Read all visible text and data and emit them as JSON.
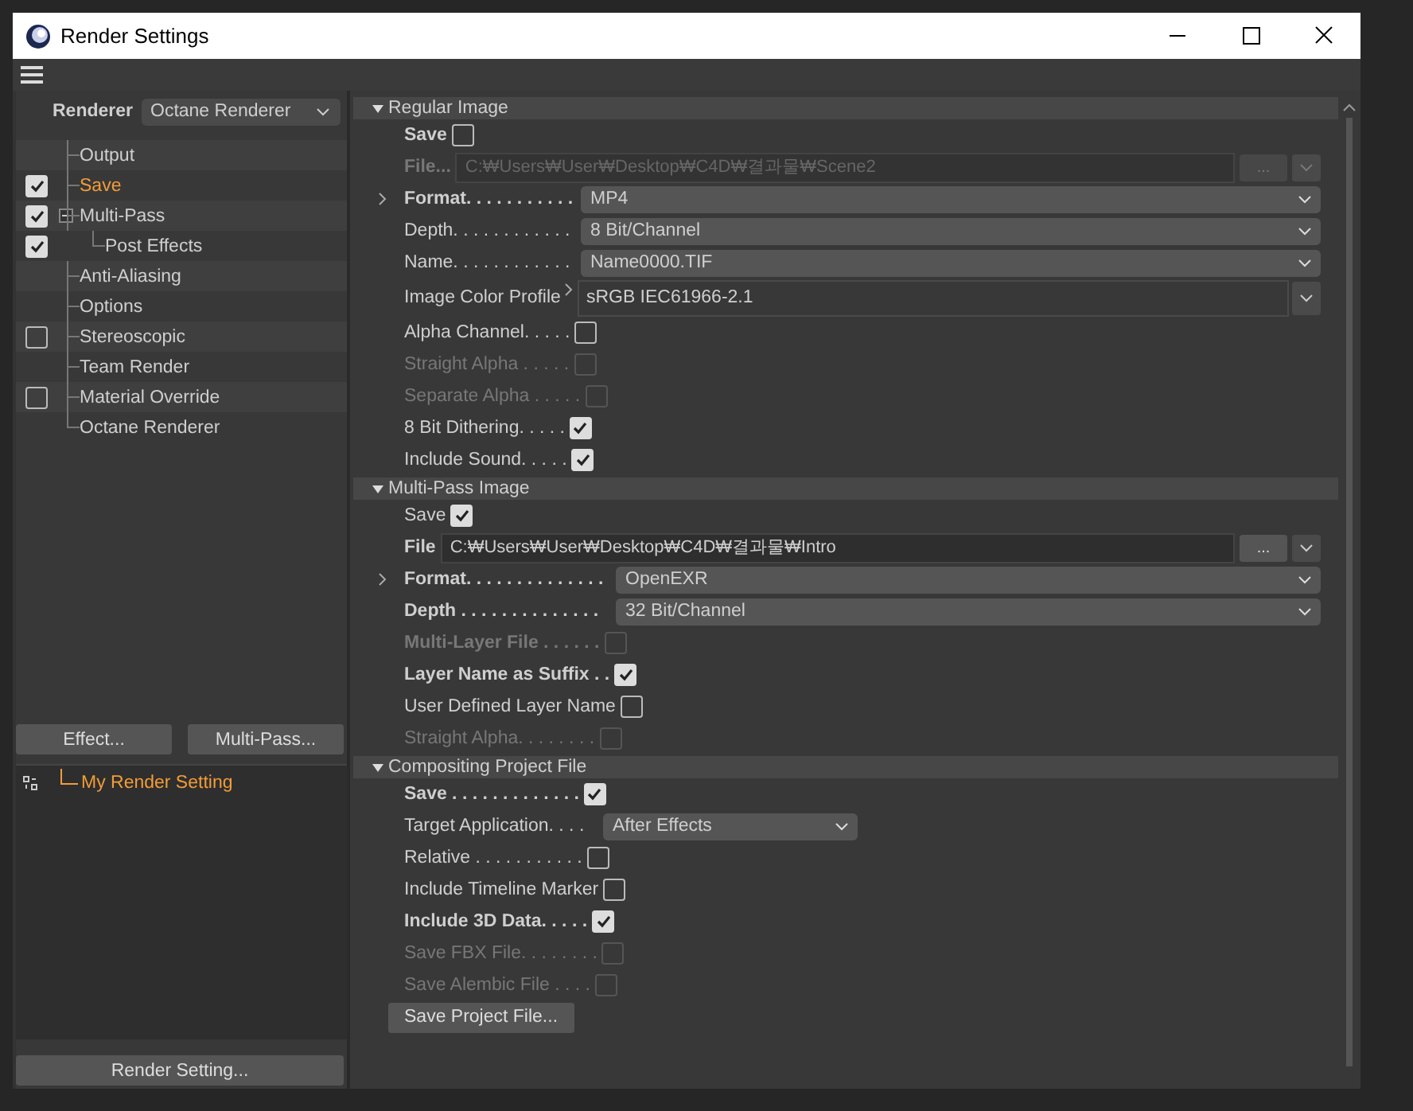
{
  "window": {
    "title": "Render Settings"
  },
  "renderer": {
    "label": "Renderer",
    "value": "Octane Renderer"
  },
  "tree": [
    {
      "label": "Output",
      "selected": false
    },
    {
      "label": "Save",
      "selected": true,
      "checked": true
    },
    {
      "label": "Multi-Pass",
      "selected": false,
      "checked": true,
      "expanded": true,
      "children": [
        {
          "label": "Post Effects",
          "selected": false,
          "checked": true
        }
      ]
    },
    {
      "label": "Anti-Aliasing",
      "selected": false
    },
    {
      "label": "Options",
      "selected": false
    },
    {
      "label": "Stereoscopic",
      "selected": false,
      "checked": false
    },
    {
      "label": "Team Render",
      "selected": false
    },
    {
      "label": "Material Override",
      "selected": false,
      "checked": false
    },
    {
      "label": "Octane Renderer",
      "selected": false
    }
  ],
  "left_buttons": [
    "Effect...",
    "Multi-Pass..."
  ],
  "presets": [
    {
      "label": "My Render Setting",
      "selected": true
    }
  ],
  "bottom_button": "Render Setting...",
  "sections": [
    {
      "title": "Regular Image",
      "expanded": true,
      "rows": [
        {
          "kind": "checkbox",
          "label": "Save",
          "bold": true,
          "disabled": false,
          "checked": false
        },
        {
          "kind": "file",
          "label": "File...",
          "bold": true,
          "disabled": true,
          "value": "C:₩Users₩User₩Desktop₩C4D₩결과물₩Scene2",
          "browse": "..."
        },
        {
          "kind": "dropdown",
          "label": "Format. . . . . . . . . . .",
          "bold": true,
          "disabled": false,
          "expandable": true,
          "value": "MP4"
        },
        {
          "kind": "dropdown",
          "label": "Depth. . . . . . . . . . . .",
          "bold": false,
          "disabled": false,
          "value": "8 Bit/Channel"
        },
        {
          "kind": "dropdown",
          "label": "Name. . . . . . . . . . . .",
          "bold": false,
          "disabled": false,
          "value": "Name0000.TIF"
        },
        {
          "kind": "profile",
          "label": "Image Color Profile",
          "bold": false,
          "disabled": false,
          "value": "sRGB IEC61966-2.1"
        },
        {
          "kind": "checkbox",
          "label": "Alpha Channel. . . . .",
          "bold": false,
          "disabled": false,
          "checked": false
        },
        {
          "kind": "checkbox",
          "label": "Straight Alpha . . . . .",
          "bold": false,
          "disabled": true,
          "checked": false
        },
        {
          "kind": "checkbox",
          "label": "Separate Alpha . . . . .",
          "bold": false,
          "disabled": true,
          "checked": false
        },
        {
          "kind": "checkbox",
          "label": "8 Bit Dithering. . . . .",
          "bold": false,
          "disabled": false,
          "checked": true
        },
        {
          "kind": "checkbox",
          "label": "Include Sound. . . . .",
          "bold": false,
          "disabled": false,
          "checked": true
        }
      ]
    },
    {
      "title": "Multi-Pass Image",
      "expanded": true,
      "rows": [
        {
          "kind": "checkbox",
          "label": "Save",
          "bold": false,
          "disabled": false,
          "checked": true
        },
        {
          "kind": "file",
          "label": "File",
          "bold": true,
          "disabled": false,
          "value": "C:₩Users₩User₩Desktop₩C4D₩결과물₩Intro",
          "browse": "..."
        },
        {
          "kind": "dropdown",
          "label": "Format. . . . . . . . . . . . . .",
          "bold": true,
          "disabled": false,
          "expandable": true,
          "value": "OpenEXR"
        },
        {
          "kind": "dropdown",
          "label": "Depth . . . . . . . . . . . . . .",
          "bold": true,
          "disabled": false,
          "value": "32 Bit/Channel"
        },
        {
          "kind": "checkbox",
          "label": "Multi-Layer File . . . . . .",
          "bold": true,
          "disabled": true,
          "checked": false
        },
        {
          "kind": "checkbox",
          "label": "Layer Name as Suffix . .",
          "bold": true,
          "disabled": false,
          "checked": true
        },
        {
          "kind": "checkbox",
          "label": "User Defined Layer Name",
          "bold": false,
          "disabled": false,
          "checked": false
        },
        {
          "kind": "checkbox",
          "label": "Straight Alpha. . . . . . . .",
          "bold": false,
          "disabled": true,
          "checked": false
        }
      ]
    },
    {
      "title": "Compositing Project File",
      "expanded": true,
      "rows": [
        {
          "kind": "checkbox",
          "label": "Save . . . . . . . . . . . . .",
          "bold": true,
          "disabled": false,
          "checked": true
        },
        {
          "kind": "dropdown",
          "label": "Target Application. . . .",
          "bold": false,
          "disabled": false,
          "compact": true,
          "value": "After Effects"
        },
        {
          "kind": "checkbox",
          "label": "Relative . . . . . . . . . . .",
          "bold": false,
          "disabled": false,
          "checked": false
        },
        {
          "kind": "checkbox",
          "label": "Include Timeline Marker",
          "bold": false,
          "disabled": false,
          "checked": false
        },
        {
          "kind": "checkbox",
          "label": "Include 3D Data. . . . .",
          "bold": true,
          "disabled": false,
          "checked": true
        },
        {
          "kind": "checkbox",
          "label": "Save FBX File. . . . . . . .",
          "bold": false,
          "disabled": true,
          "checked": false
        },
        {
          "kind": "checkbox",
          "label": "Save Alembic File . . . .",
          "bold": false,
          "disabled": true,
          "checked": false
        },
        {
          "kind": "button",
          "label": "Save Project File..."
        }
      ]
    }
  ]
}
